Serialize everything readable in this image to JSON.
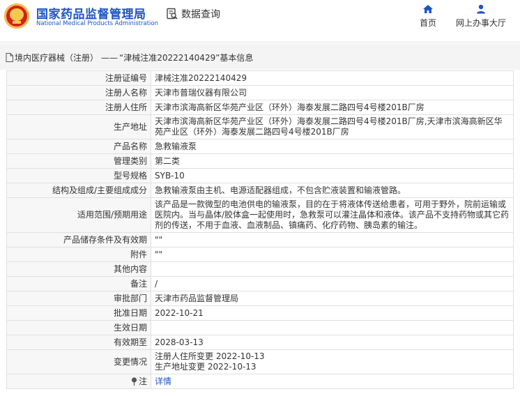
{
  "header": {
    "brand_cn": "国家药品监督管理局",
    "brand_en": "National Medical Products Administration",
    "query_label": "数据查询",
    "nav": {
      "home": "首页",
      "office": "网上办事大厅"
    },
    "accent_color": "#1b55c4"
  },
  "breadcrumb": {
    "category": "境内医疗器械（注册）",
    "separator": "——",
    "title": "“津械注准20222140429”基本信息"
  },
  "detail": {
    "rows": [
      {
        "label": "注册证编号",
        "value": "津械注准20222140429"
      },
      {
        "label": "注册人名称",
        "value": "天津市普瑞仪器有限公司"
      },
      {
        "label": "注册人住所",
        "value": "天津市滨海高新区华苑产业区（环外）海泰发展二路四号4号楼201B厂房"
      },
      {
        "label": "生产地址",
        "value": "天津市滨海高新区华苑产业区（环外）海泰发展二路四号4号楼201B厂房,天津市滨海高新区华苑产业区（环外）海泰发展二路四号4号楼201B厂房"
      },
      {
        "label": "产品名称",
        "value": "急救输液泵"
      },
      {
        "label": "管理类别",
        "value": "第二类"
      },
      {
        "label": "型号规格",
        "value": "SYB-10"
      },
      {
        "label": "结构及组成/主要组成成分",
        "value": "急救输液泵由主机、电源适配器组成，不包含贮液装置和输液管路。"
      },
      {
        "label": "适用范围/预期用途",
        "value": "该产品是一款微型的电池供电的输液泵，目的在于将液体传送给患者，可用于野外，院前运输或医院内。当与晶体/胶体盒一起使用时，急救泵可以灌注晶体和液体。该产品不支持药物或其它药剂的传送，不用于血液、血液制品、镇痛药、化疗药物、胰岛素的输注。"
      },
      {
        "label": "产品储存条件及有效期",
        "value": "\"\""
      },
      {
        "label": "附件",
        "value": "\"\""
      },
      {
        "label": "其他内容",
        "value": ""
      },
      {
        "label": "备注",
        "value": "/"
      },
      {
        "label": "审批部门",
        "value": "天津市药品监督管理局"
      },
      {
        "label": "批准日期",
        "value": "2022-10-21"
      },
      {
        "label": "生效日期",
        "value": ""
      },
      {
        "label": "有效期至",
        "value": "2028-03-13"
      },
      {
        "label": "变更情况",
        "value_line1": "注册人住所变更 2022-10-13",
        "value_line2": "生产地址变更 2022-10-13"
      },
      {
        "label": "注",
        "link": "详情"
      }
    ]
  }
}
